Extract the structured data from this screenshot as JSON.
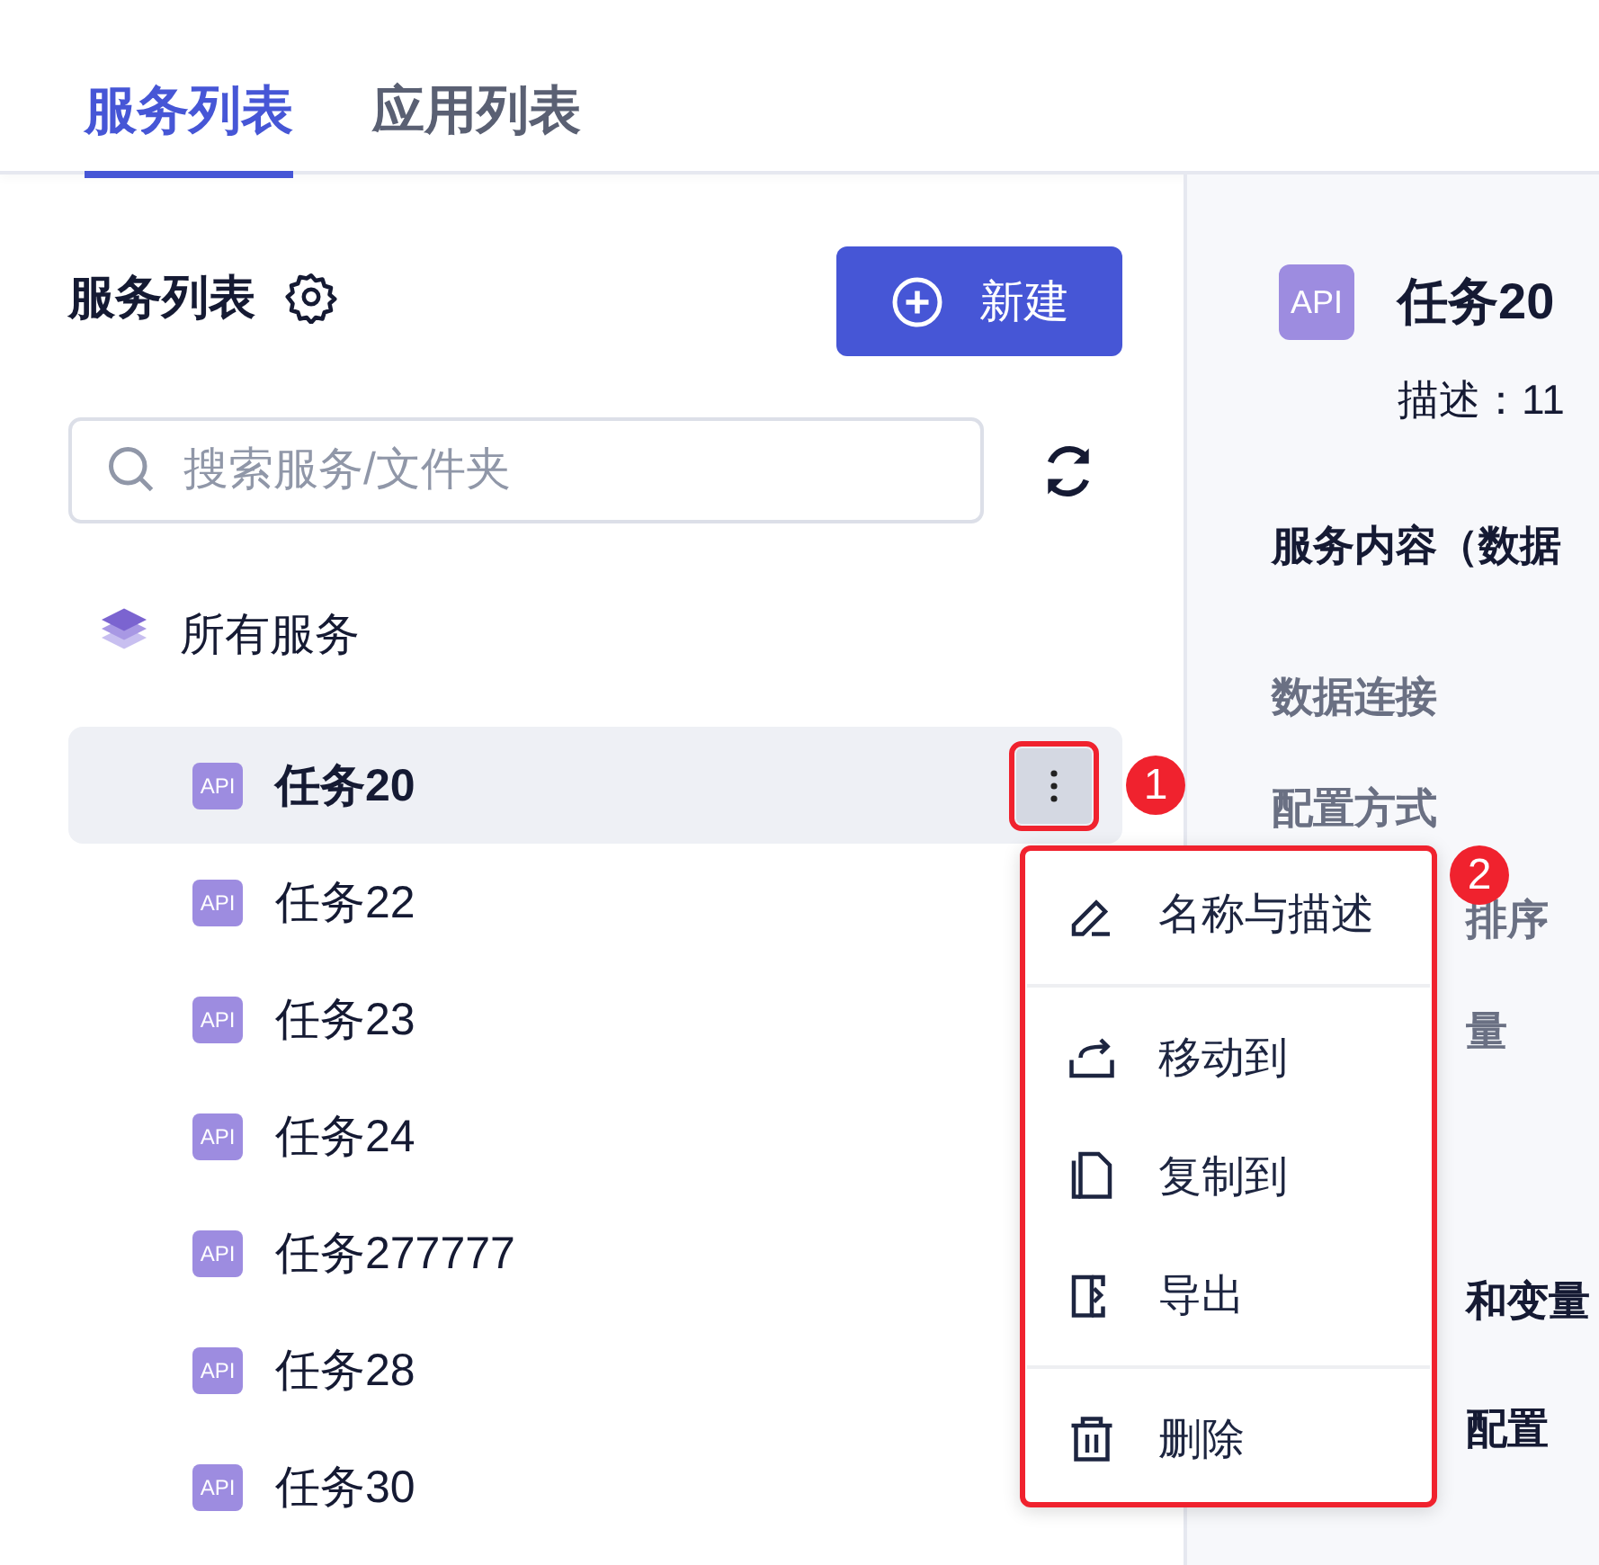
{
  "tabs": [
    {
      "label": "服务列表",
      "selected": true
    },
    {
      "label": "应用列表",
      "selected": false
    }
  ],
  "sidebar": {
    "title": "服务列表",
    "new_button": "新建",
    "search": {
      "placeholder": "搜索服务/文件夹"
    },
    "all_label": "所有服务",
    "items": [
      {
        "badge": "API",
        "name": "任务20",
        "selected": true
      },
      {
        "badge": "API",
        "name": "任务22",
        "selected": false
      },
      {
        "badge": "API",
        "name": "任务23",
        "selected": false
      },
      {
        "badge": "API",
        "name": "任务24",
        "selected": false
      },
      {
        "badge": "API",
        "name": "任务277777",
        "selected": false
      },
      {
        "badge": "API",
        "name": "任务28",
        "selected": false
      },
      {
        "badge": "API",
        "name": "任务30",
        "selected": false
      }
    ]
  },
  "context_menu": {
    "groups": [
      [
        {
          "kind": "edit",
          "label": "名称与描述"
        }
      ],
      [
        {
          "kind": "move",
          "label": "移动到"
        },
        {
          "kind": "copy",
          "label": "复制到"
        },
        {
          "kind": "export",
          "label": "导出"
        }
      ],
      [
        {
          "kind": "delete",
          "label": "删除"
        }
      ]
    ]
  },
  "detail": {
    "badge": "API",
    "title": "任务20",
    "description": "描述：11",
    "section": "服务内容（数据",
    "rows": [
      {
        "kind": "full",
        "label": "数据连接"
      },
      {
        "kind": "full",
        "label": "配置方式"
      },
      {
        "kind": "covered",
        "label": "排序"
      },
      {
        "kind": "covered",
        "label": "量"
      },
      {
        "kind": "gap"
      },
      {
        "kind": "strong",
        "label": "和变量"
      },
      {
        "kind": "strong",
        "label": "配置"
      }
    ]
  },
  "annotations": [
    {
      "label": "1"
    },
    {
      "label": "2"
    }
  ]
}
